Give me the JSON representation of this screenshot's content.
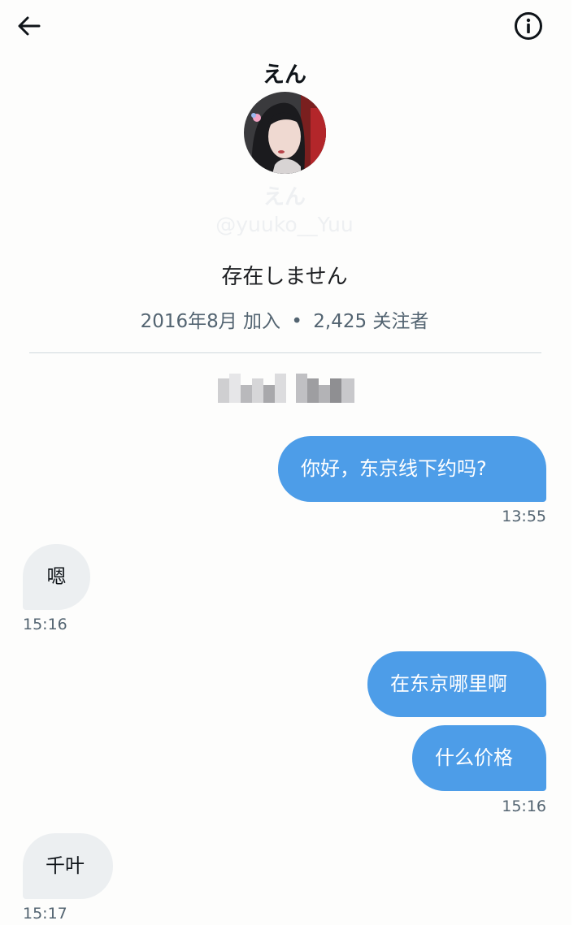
{
  "header": {
    "back_icon": "arrow-left-icon",
    "info_icon": "info-circle-icon"
  },
  "profile": {
    "display_name": "えん",
    "display_name_faded": "えん",
    "handle_faded": "@yuuko__Yuu",
    "status_text": "存在しません",
    "joined": "2016年8月 加入",
    "separator": "•",
    "followers": "2,425 关注者"
  },
  "messages": [
    {
      "direction": "outgoing",
      "text": "你好，东京线下约吗?"
    },
    {
      "direction": "outgoing_time",
      "text": "13:55"
    },
    {
      "direction": "incoming",
      "text": "嗯"
    },
    {
      "direction": "incoming_time",
      "text": "15:16"
    },
    {
      "direction": "outgoing",
      "text": "在东京哪里啊"
    },
    {
      "direction": "outgoing",
      "text": "什么价格"
    },
    {
      "direction": "outgoing_time",
      "text": "15:16"
    },
    {
      "direction": "incoming",
      "text": "千叶"
    },
    {
      "direction": "incoming_time",
      "text": "15:17"
    }
  ],
  "colors": {
    "outgoing_bubble": "#4d9de8",
    "incoming_bubble": "#eceff1",
    "meta_text": "#536471"
  }
}
